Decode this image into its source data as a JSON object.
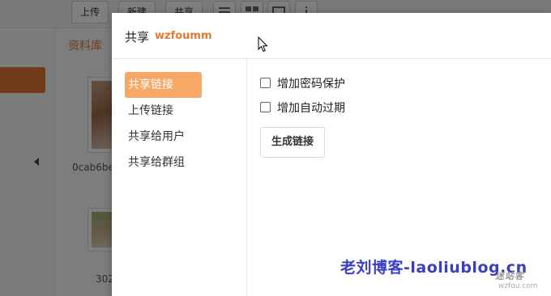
{
  "toolbar": {
    "upload_label": "上传",
    "new_label": "新建",
    "share_label": "共享"
  },
  "library": {
    "title": "资料库"
  },
  "files": [
    {
      "name": "0cab6be"
    },
    {
      "name": "302"
    }
  ],
  "dialog": {
    "title": "共享",
    "username": "wzfoumm",
    "nav": [
      {
        "label": "共享链接",
        "active": true
      },
      {
        "label": "上传链接",
        "active": false
      },
      {
        "label": "共享给用户",
        "active": false
      },
      {
        "label": "共享给群组",
        "active": false
      }
    ],
    "options": [
      {
        "label": "增加密码保护",
        "checked": false
      },
      {
        "label": "增加自动过期",
        "checked": false
      }
    ],
    "generate_label": "生成链接"
  },
  "watermark": {
    "text": "老刘博客-laoliublog.cn",
    "logo": "迷站客",
    "url": "wzfou.com"
  },
  "colors": {
    "accent": "#e07b33",
    "nav_active_bg": "#f7a766",
    "watermark": "#3b3fbf"
  }
}
